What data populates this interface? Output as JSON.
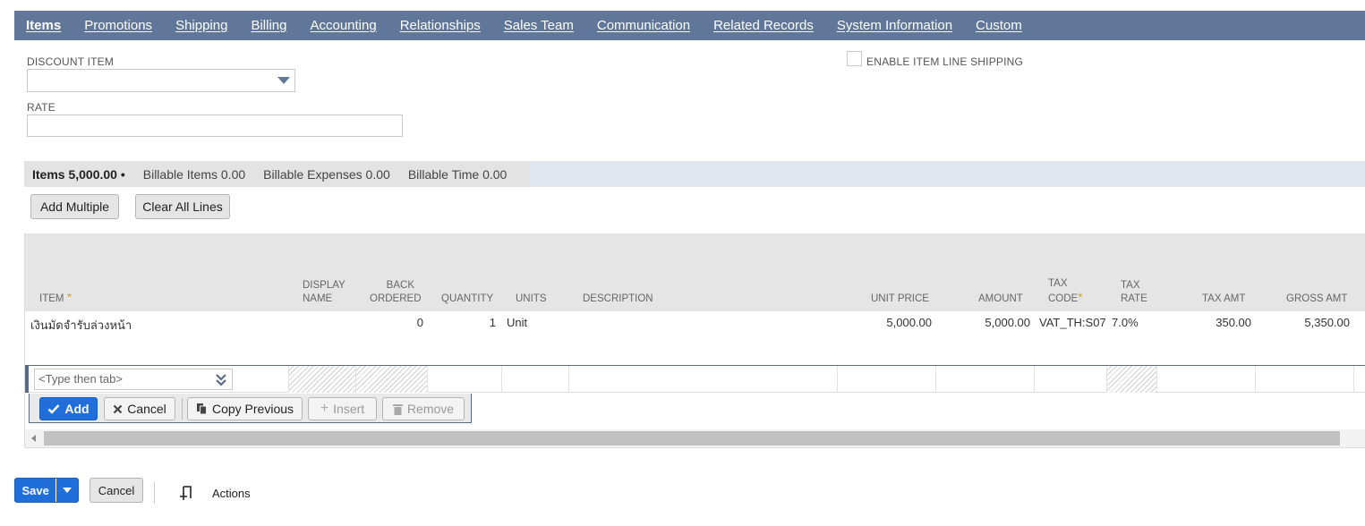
{
  "tabs": [
    {
      "label": "Items",
      "active": true
    },
    {
      "label": "Promotions"
    },
    {
      "label": "Shipping"
    },
    {
      "label": "Billing"
    },
    {
      "label": "Accounting"
    },
    {
      "label": "Relationships"
    },
    {
      "label": "Sales Team"
    },
    {
      "label": "Communication"
    },
    {
      "label": "Related Records"
    },
    {
      "label": "System Information"
    },
    {
      "label": "Custom"
    }
  ],
  "form": {
    "discount_item_label": "DISCOUNT ITEM",
    "discount_item_value": "",
    "rate_label": "RATE",
    "rate_value": "",
    "enable_item_line_shipping_label": "ENABLE ITEM LINE SHIPPING",
    "enable_item_line_shipping_checked": false
  },
  "subtabs": {
    "items": "Items 5,000.00 •",
    "billable_items": "Billable Items 0.00",
    "billable_expenses": "Billable Expenses 0.00",
    "billable_time": "Billable Time 0.00"
  },
  "toolbar": {
    "add_multiple": "Add Multiple",
    "clear_all_lines": "Clear All Lines"
  },
  "grid": {
    "headers": {
      "item": "ITEM",
      "display_name_1": "DISPLAY",
      "display_name_2": "NAME",
      "back_ordered_1": "BACK",
      "back_ordered_2": "ORDERED",
      "quantity": "QUANTITY",
      "units": "UNITS",
      "description": "DESCRIPTION",
      "unit_price": "UNIT PRICE",
      "amount": "AMOUNT",
      "tax_code_1": "TAX",
      "tax_code_2": "CODE",
      "tax_rate_1": "TAX",
      "tax_rate_2": "RATE",
      "tax_amt": "TAX AMT",
      "gross_amt": "GROSS AMT",
      "required_mark": "*"
    },
    "rows": [
      {
        "item": "เงินมัดจำรับล่วงหน้า",
        "display_name": "",
        "back_ordered": "0",
        "quantity": "1",
        "units": "Unit",
        "description": "",
        "unit_price": "5,000.00",
        "amount": "5,000.00",
        "tax_code": "VAT_TH:S07",
        "tax_rate": "7.0%",
        "tax_amt": "350.00",
        "gross_amt": "5,350.00"
      }
    ],
    "edit_row": {
      "item_placeholder": "<Type then tab>"
    },
    "line_actions": {
      "add": "Add",
      "cancel": "Cancel",
      "copy_previous": "Copy Previous",
      "insert": "Insert",
      "remove": "Remove"
    }
  },
  "footer": {
    "save": "Save",
    "cancel": "Cancel",
    "actions": "Actions"
  },
  "colors": {
    "tabbar": "#607799",
    "primary": "#1f6ed9",
    "required": "#d5a23b"
  }
}
